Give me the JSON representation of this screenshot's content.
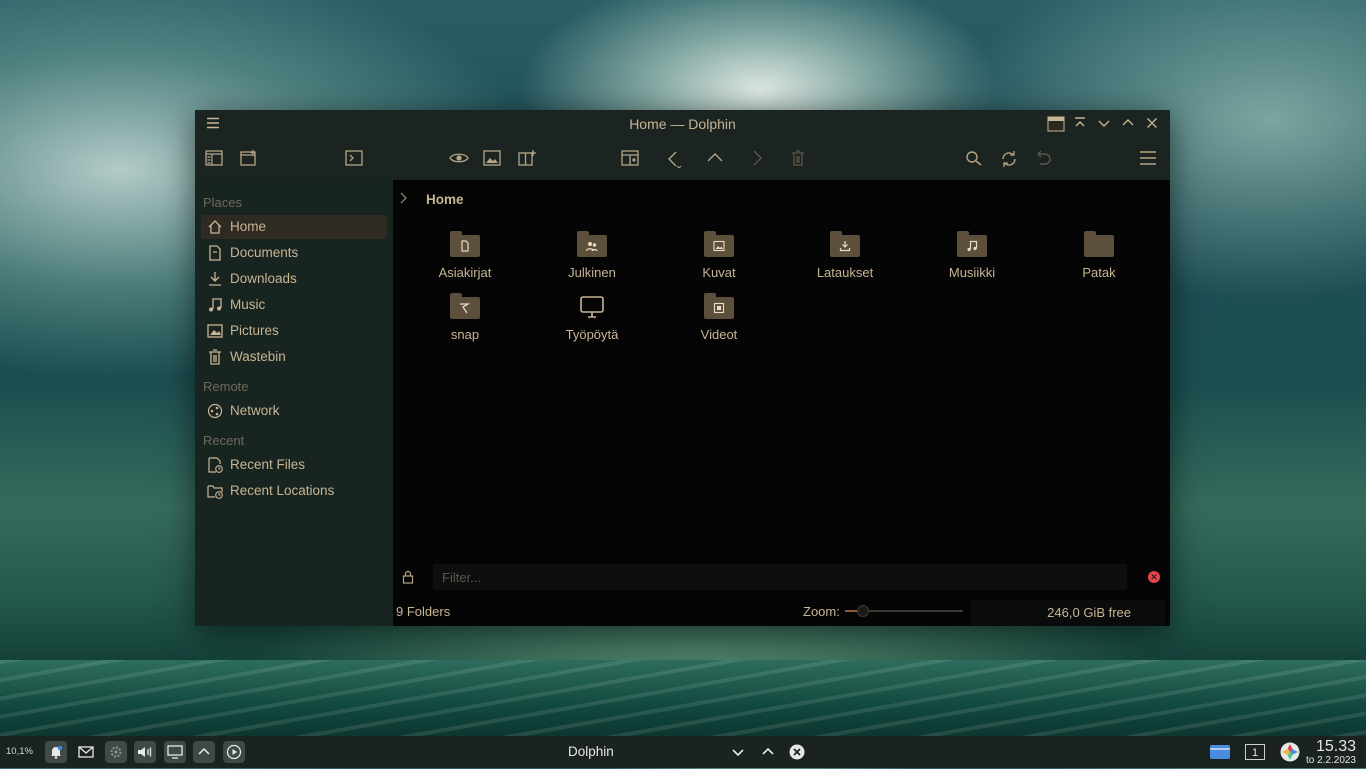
{
  "window": {
    "title": "Home — Dolphin"
  },
  "sidebar": {
    "places_label": "Places",
    "places": [
      {
        "label": "Home",
        "icon": "home-icon",
        "active": true
      },
      {
        "label": "Documents",
        "icon": "document-icon"
      },
      {
        "label": "Downloads",
        "icon": "download-icon"
      },
      {
        "label": "Music",
        "icon": "music-icon"
      },
      {
        "label": "Pictures",
        "icon": "picture-icon"
      },
      {
        "label": "Wastebin",
        "icon": "trash-icon"
      }
    ],
    "remote_label": "Remote",
    "remote": [
      {
        "label": "Network",
        "icon": "network-icon"
      }
    ],
    "recent_label": "Recent",
    "recent": [
      {
        "label": "Recent Files",
        "icon": "recent-files-icon"
      },
      {
        "label": "Recent Locations",
        "icon": "recent-locations-icon"
      }
    ]
  },
  "breadcrumb": {
    "current": "Home"
  },
  "items": [
    {
      "name": "Asiakirjat",
      "icon": "folder-documents-icon"
    },
    {
      "name": "Julkinen",
      "icon": "folder-public-icon"
    },
    {
      "name": "Kuvat",
      "icon": "folder-pictures-icon"
    },
    {
      "name": "Lataukset",
      "icon": "folder-downloads-icon"
    },
    {
      "name": "Musiikki",
      "icon": "folder-music-icon"
    },
    {
      "name": "Patak",
      "icon": "folder-icon"
    },
    {
      "name": "snap",
      "icon": "folder-snap-icon"
    },
    {
      "name": "Työpöytä",
      "icon": "desktop-icon"
    },
    {
      "name": "Videot",
      "icon": "folder-videos-icon"
    }
  ],
  "filter": {
    "placeholder": "Filter..."
  },
  "status": {
    "summary": "9 Folders",
    "zoom_label": "Zoom:",
    "zoom_level": 0.15,
    "free_space": "246,0 GiB free"
  },
  "taskbar": {
    "cpu": "10,1%",
    "task_title": "Dolphin",
    "desktop_number": "1",
    "time": "15.33",
    "date": "to 2.2.2023"
  },
  "colors": {
    "accent": "#c8b594",
    "folder": "#5c4f3b",
    "clear_button": "#e0454a"
  }
}
